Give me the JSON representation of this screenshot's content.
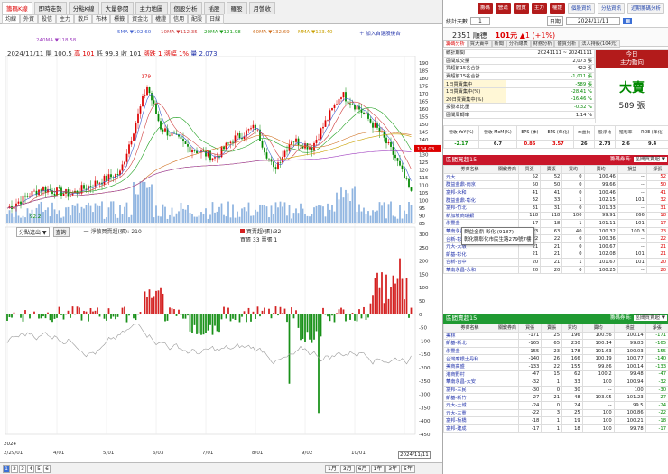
{
  "tabs_row1": [
    "籌碼K線",
    "即時走勢",
    "分點K線",
    "大量參閱",
    "主力地圖",
    "個股分析",
    "插股",
    "羅股",
    "月營收"
  ],
  "tabs_row2": [
    "均線",
    "外資",
    "投信",
    "主力",
    "散戶",
    "布林",
    "標籤",
    "資金比",
    "權證",
    "信用",
    "配股",
    "日線"
  ],
  "ma_labels": [
    {
      "text": "5MA ▼102.60",
      "color": "#4060d0"
    },
    {
      "text": "10MA ▼112.35",
      "color": "#d04040"
    },
    {
      "text": "20MA ▼121.98",
      "color": "#20a020"
    },
    {
      "text": "60MA ▼132.69",
      "color": "#d07020"
    },
    {
      "text": "MMA ▼133.40",
      "color": "#c9a000"
    },
    {
      "text": "240MA ▼118.58",
      "color": "#a040c0"
    }
  ],
  "chart_info": {
    "date": "2024/11/11",
    "open": "開 100.5",
    "high": "高 101",
    "low": "低 99.3",
    "close": "收 101",
    "change": "漲跌 1",
    "pct": "漲幅 1%",
    "volume": "量 2,073"
  },
  "add_button": "＋ 加入自選股後台",
  "watch_label": "▼自選股",
  "right_panel": {
    "top_buttons": [
      "籌碼",
      "營運",
      "體質",
      "主力",
      "權證"
    ],
    "top_links": [
      "個股資訊",
      "分點資訊",
      "近期籌碼分析"
    ],
    "period_label": "統計天數",
    "period_value": "1",
    "date_label": "日期",
    "date_value": "2024/11/11",
    "stock_code": "2351",
    "stock_name": "順德",
    "price": "101元",
    "change": "▲1 (+1%)",
    "tabs": [
      "籌碼分析",
      "買大賣中",
      "新聞",
      "分析總表",
      "財務分析",
      "體質分析",
      "法人持股(104元)"
    ],
    "today": "今日",
    "main_force": "主力動向",
    "big_sell": "大賣",
    "big_sell_lots": "589 張",
    "stats": [
      {
        "label": "統計期間",
        "value": "20241111 ~ 20241111"
      },
      {
        "label": "區間成交量",
        "value": "2,073 張"
      },
      {
        "label": "買超前15名合計",
        "value": "422 張"
      },
      {
        "label": "賣超前15名合計",
        "value": "-1,011 張"
      },
      {
        "label": "1日買賣集中",
        "value": "-589 張"
      },
      {
        "label": "1日買賣集中(%)",
        "value": "-28.41 %"
      },
      {
        "label": "20日買賣集中(%)",
        "value": "-16.46 %"
      },
      {
        "label": "投發本比重",
        "value": "-0.32 %"
      },
      {
        "label": "區間周轉率",
        "value": "1.14 %"
      }
    ],
    "fin_headers": [
      "營收 YoY(%)",
      "營收 MoM(%)",
      "EPS (季)",
      "EPS (年化)",
      "本益比",
      "股淨比",
      "殖利率",
      "ROE (年化)"
    ],
    "fin_values": [
      "-2.17",
      "6.7",
      "0.86",
      "3.57",
      "26",
      "2.73",
      "2.6",
      "9.4"
    ],
    "buy_section_title": "區間買超15",
    "sell_section_title": "區間賣超15",
    "sort_label": "籌碼券商:",
    "sort_value": "區間買賣超 ▼",
    "table_headers": [
      "券商名稱",
      "關鍵券商",
      "買張",
      "賣張",
      "買均",
      "賣均",
      "損益",
      "淨張"
    ],
    "tooltip_lines": [
      "群益金鼎-彰化 (9187)",
      "彰化縣彰化市民生路279號7樓"
    ],
    "buy_rows": [
      [
        "元大",
        "",
        "52",
        "52",
        "0",
        "100.46",
        "--",
        "52"
      ],
      [
        "群益金鼎-南京",
        "",
        "50",
        "50",
        "0",
        "99.66",
        "--",
        "50"
      ],
      [
        "富邦-永和",
        "",
        "41",
        "41",
        "0",
        "100.46",
        "--",
        "41"
      ],
      [
        "群益金鼎-彰化",
        "",
        "32",
        "33",
        "1",
        "102.15",
        "101",
        "32"
      ],
      [
        "富邦-竹北",
        "",
        "31",
        "31",
        "0",
        "101.33",
        "--",
        "31"
      ],
      [
        "新加坡商瑞銀",
        "",
        "118",
        "118",
        "100",
        "99.91",
        "266",
        "18"
      ],
      [
        "永豐金",
        "",
        "17",
        "18",
        "1",
        "101.11",
        "101",
        "17"
      ],
      [
        "華南永昌",
        "",
        "23",
        "63",
        "40",
        "100.32",
        "100.3",
        "23"
      ],
      [
        "台新-彰化",
        "",
        "22",
        "22",
        "0",
        "100.36",
        "--",
        "22"
      ],
      [
        "元大-大墩",
        "",
        "21",
        "21",
        "0",
        "100.67",
        "--",
        "21"
      ],
      [
        "凱基-彰化",
        "",
        "21",
        "21",
        "0",
        "102.08",
        "101",
        "21"
      ],
      [
        "台新-台中",
        "",
        "20",
        "21",
        "1",
        "101.67",
        "101",
        "20"
      ],
      [
        "華南永昌-永和",
        "",
        "20",
        "20",
        "0",
        "100.25",
        "--",
        "20"
      ]
    ],
    "sell_rows": [
      [
        "美林",
        "",
        "-171",
        "25",
        "196",
        "100.56",
        "100.14",
        "-171"
      ],
      [
        "凱基-新北",
        "",
        "-165",
        "65",
        "230",
        "100.14",
        "99.83",
        "-165"
      ],
      [
        "永豐金",
        "",
        "-155",
        "23",
        "178",
        "101.63",
        "100.03",
        "-155"
      ],
      [
        "台灣摩根士丹利",
        "",
        "-140",
        "26",
        "166",
        "100.19",
        "100.77",
        "-140"
      ],
      [
        "美商高盛",
        "",
        "-133",
        "22",
        "155",
        "99.86",
        "100.14",
        "-133"
      ],
      [
        "港商野村",
        "",
        "-47",
        "15",
        "62",
        "100.2",
        "99.48",
        "-47"
      ],
      [
        "華南永昌-大安",
        "",
        "-32",
        "1",
        "33",
        "100",
        "100.94",
        "-32"
      ],
      [
        "富邦-三民",
        "",
        "-30",
        "0",
        "30",
        "--",
        "100",
        "-30"
      ],
      [
        "凱基-新竹",
        "",
        "-27",
        "21",
        "48",
        "103.95",
        "101.23",
        "-27"
      ],
      [
        "元大-土城",
        "",
        "-24",
        "0",
        "24",
        "--",
        "99.5",
        "-24"
      ],
      [
        "元大-三重",
        "",
        "-22",
        "3",
        "25",
        "100",
        "100.86",
        "-22"
      ],
      [
        "富邦-板橋",
        "",
        "-18",
        "1",
        "19",
        "100",
        "100.21",
        "-18"
      ],
      [
        "富邦-建成",
        "",
        "-17",
        "1",
        "18",
        "100",
        "99.78",
        "-17"
      ]
    ]
  },
  "volume_info": {
    "label": "分點進出 ▼",
    "btn": "查詢",
    "net": "一 淨散買賣超(張):-210",
    "buy_sell": "買賣超(張):32",
    "buy_lots": "買張 33",
    "sell_lots": "賣張 1"
  },
  "price_axis": [
    "190",
    "185",
    "180",
    "175",
    "170",
    "165",
    "160",
    "155",
    "150",
    "145",
    "140",
    "135",
    "130",
    "125",
    "120",
    "115",
    "110",
    "105",
    "100",
    "95",
    "90",
    "85"
  ],
  "sub_axis": [
    "300",
    "250",
    "200",
    "150",
    "100",
    "50",
    "0",
    "-50",
    "-100",
    "-150",
    "-200",
    "-250",
    "-300",
    "-350",
    "-400",
    "-450"
  ],
  "date_axis": [
    "2/29/01",
    "4/01",
    "5/01",
    "6/03",
    "7/01",
    "8/01",
    "9/02",
    "10/01",
    "11/01"
  ],
  "year_label": "2024",
  "current_price_tag": "134.03",
  "bottom_date": "2024/11/11",
  "pages": [
    "1",
    "2",
    "3",
    "4",
    "5",
    "6"
  ],
  "periods": [
    "1月",
    "3月",
    "6月",
    "1年",
    "3年",
    "5年"
  ],
  "peak_label": "179",
  "low_label": "92.2",
  "colors": {
    "up": "#d00",
    "down": "#080",
    "accent": "#b31b1b",
    "buy_bar": "#d42020",
    "sell_bar": "#189018"
  }
}
